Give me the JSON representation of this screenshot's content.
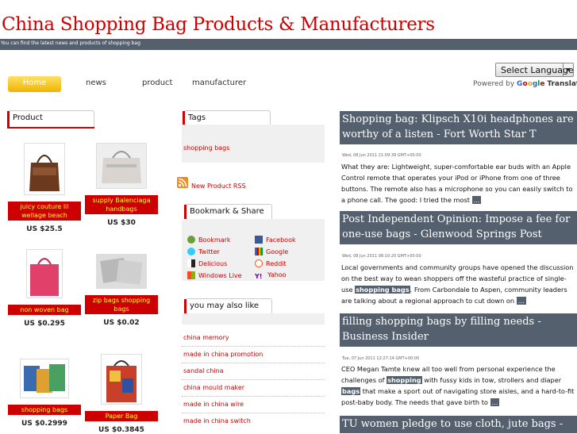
{
  "site": {
    "title": "China Shopping Bag Products & Manufacturers",
    "tagline": "You can find the latest news and products of shopping bag"
  },
  "language": {
    "select_label": "Select Language",
    "powered_by": "Powered by",
    "google": "Google",
    "translate": "Translate"
  },
  "nav": {
    "home": "Home",
    "news": "news",
    "product": "product",
    "manufacturer": "manufacturer"
  },
  "products": {
    "heading": "Product",
    "items": [
      {
        "name": "juicy couture lil wellage beach",
        "price": "US $25.5"
      },
      {
        "name": "supply Balenciaga handbags",
        "price": "US $30"
      },
      {
        "name": "non woven bag",
        "price": "US $0.295"
      },
      {
        "name": "zip bags shopping bags",
        "price": "US $0.02"
      },
      {
        "name": "shopping bags",
        "price": "US $0.2999"
      },
      {
        "name": "Paper Bag",
        "price": "US $0.3845"
      }
    ]
  },
  "tags": {
    "heading": "Tags",
    "items": [
      "shopping bags"
    ]
  },
  "rss": {
    "label": "New Product RSS"
  },
  "bookmark": {
    "heading": "Bookmark & Share",
    "items": [
      "Bookmark",
      "Facebook",
      "Twitter",
      "Google",
      "Delicious",
      "Reddit",
      "Windows Live",
      "Yahoo"
    ]
  },
  "also_like": {
    "heading": "you may also like",
    "items": [
      "china memory",
      "made in china promotion",
      "sandal china",
      "china mould maker",
      "made in china wire",
      "made in china switch"
    ]
  },
  "articles": [
    {
      "title": "Shopping bag: Klipsch X10i headphones are worthy of a listen - Fort Worth Star T",
      "date": "Wed, 08 Jun 2011 21:09:39 GMT+00:00",
      "body": "What they are: Lightweight, super-comfortable ear buds with an Apple Control remote that operates your iPod or iPhone from one of three buttons. The remote also has a microphone so you can easily switch to a phone call. The good: I tried the most",
      "more": "..."
    },
    {
      "title": "Post Independent Opinion: Impose a fee for one-use bags - Glenwood Springs Post",
      "date": "Wed, 08 Jun 2011 08:10:20 GMT+00:00",
      "body_a": "Local governments and community groups have opened the discussion on the best way to wean shoppers off the wasteful practice of single-use",
      "hl": "shopping bags",
      "body_b": ". From Carbondale to Aspen, community leaders are talking about a regional approach to cut down on",
      "more": "..."
    },
    {
      "title": "filling shopping bags by filling needs - Business Insider",
      "date": "Tue, 07 Jun 2011 12:27:14 GMT+00:00",
      "body_a": "CEO Megan Tamte knew all too well from personal experience the challenges of",
      "hl1": "shopping",
      "body_b": "with fussy kids in tow, strollers and diaper",
      "hl2": "bags",
      "body_c": "that make a sport out of navigating store aisles, and a hard-to-fit post-baby body. The needs that gave birth to",
      "more": "..."
    },
    {
      "title": "TU women pledge to use cloth, jute bags -"
    }
  ],
  "colors": {
    "accent": "#cc0000",
    "bar": "#55606f",
    "home": "#f0b400"
  }
}
